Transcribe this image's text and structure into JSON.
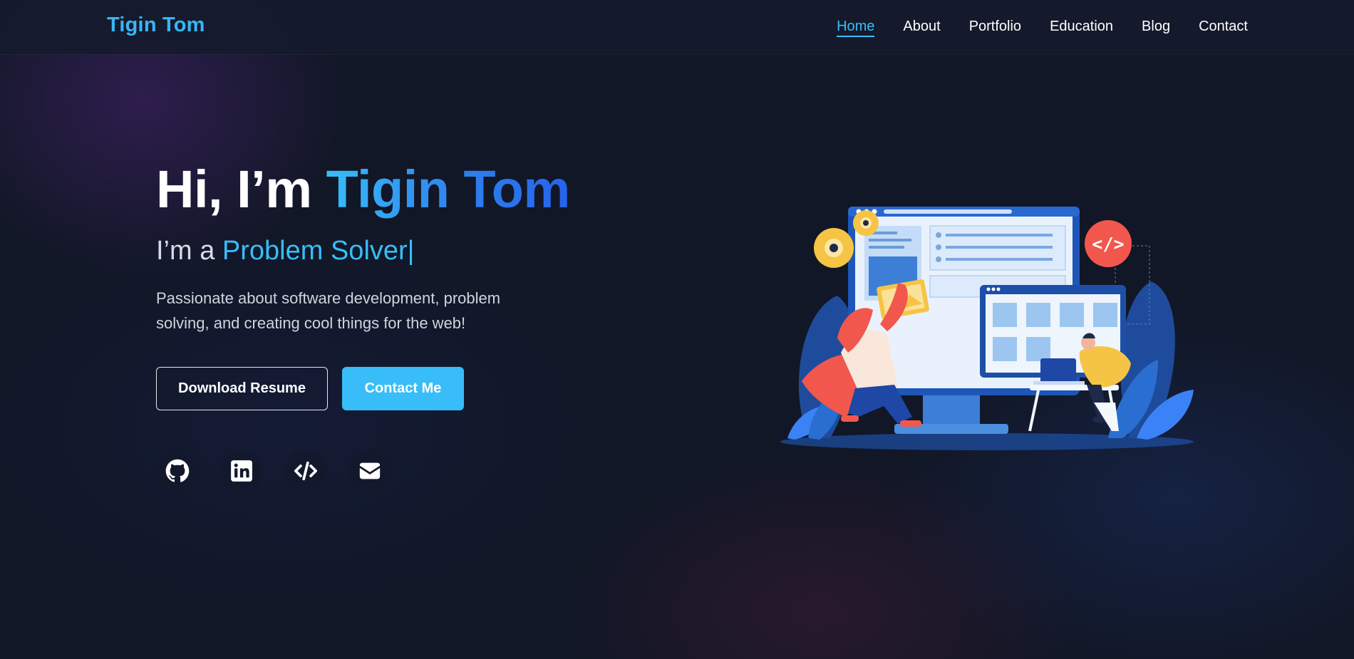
{
  "nav": {
    "brand": "Tigin Tom",
    "items": [
      {
        "label": "Home",
        "active": true
      },
      {
        "label": "About",
        "active": false
      },
      {
        "label": "Portfolio",
        "active": false
      },
      {
        "label": "Education",
        "active": false
      },
      {
        "label": "Blog",
        "active": false
      },
      {
        "label": "Contact",
        "active": false
      }
    ]
  },
  "hero": {
    "greeting": "Hi, I’m ",
    "name": "Tigin Tom",
    "role_prefix": "I’m a ",
    "role": "Problem Solver",
    "cursor": "|",
    "description": "Passionate about software development, problem solving, and creating cool things for the web!",
    "buttons": {
      "resume": "Download Resume",
      "contact": "Contact Me"
    },
    "socials": [
      {
        "icon": "github-icon"
      },
      {
        "icon": "linkedin-icon"
      },
      {
        "icon": "code-icon"
      },
      {
        "icon": "envelope-icon"
      }
    ]
  },
  "colors": {
    "accent": "#38bdf8",
    "brand": "#38b6f6",
    "background": "#111726"
  }
}
